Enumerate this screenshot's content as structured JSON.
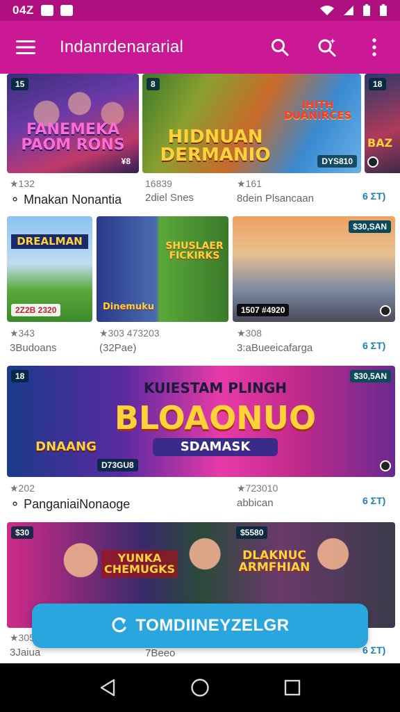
{
  "status_bar": {
    "time": "04Z"
  },
  "app_bar": {
    "title": "Indanrdenararial",
    "menu_icon": "menu-icon",
    "search_icon": "search-icon",
    "search_alt_icon": "search-sparkle-icon",
    "more_icon": "more-vert-icon"
  },
  "row1": [
    {
      "badge": "15",
      "art_title": "FANEMEKA\nPAOM RONS",
      "corner": "¥8",
      "rating": "★132",
      "name": "Mnakan Nonantia",
      "price": ""
    },
    {
      "badge": "8",
      "art_title": "HIDNUAN\nDERMANIO",
      "art_sub": "IHITH\nDUANIRCES",
      "chip": "DYS810",
      "rating": "16839",
      "name": "2diel Snes",
      "price": ""
    },
    {
      "badge": "18",
      "art_title": "BAZ",
      "rating": "★161",
      "name": "8dein Plsancaan",
      "price": "6 ΣT)"
    }
  ],
  "row2": [
    {
      "art_title": "DREALMAN",
      "chip": "2Z2B 2320",
      "rating": "★343",
      "name": "3Budoans"
    },
    {
      "art_title": "Dinemuku",
      "art_sub": "SHUSLAER\nFICKIRKS",
      "rating": "★303 473203",
      "name": "(32Pae)"
    },
    {
      "badge": "$30,SAN",
      "chip": "1507 #4920",
      "rating": "★308",
      "name": "3:aBueeicafarga",
      "price": "6 ΣT)"
    }
  ],
  "row3": {
    "badge": "18",
    "badge_r": "$30,5AN",
    "art_title": "BLOAONUO",
    "art_top": "KUIESTAM PLINGH",
    "art_sub": "SDAMASK",
    "art_left": "DNAANG",
    "chip": "D73GU8",
    "rating_l": "★202",
    "name_l": "PanganiaiNonaoge",
    "rating_r": "★723010",
    "name_r": "abbican",
    "price": "6 ΣT)"
  },
  "row4": {
    "badge_l": "$30",
    "badge_r": "$5580",
    "art_l": "YUNKA\nCHEMUGKS",
    "art_r": "DLAKNUC\nARMFHIAN",
    "rating_l": "★305",
    "name_l": "3Jaiua",
    "name_m": "7Beeo",
    "price": "6 ΣT)"
  },
  "fab": {
    "label": "TOMDIINEYZELGR",
    "icon": "refresh-bolt-icon"
  },
  "nav": {
    "back": "back-icon",
    "home": "home-icon",
    "recents": "recents-icon"
  },
  "colors": {
    "status_bar": "#b0107f",
    "app_bar": "#cb1894",
    "fab": "#2aa6de",
    "accent": "#1b7fb5"
  }
}
